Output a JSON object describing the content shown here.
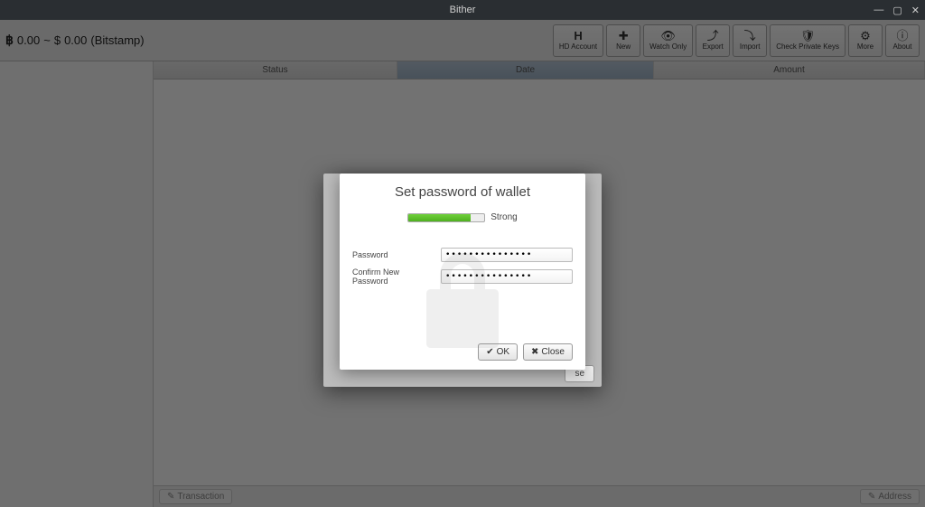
{
  "window": {
    "title": "Bither"
  },
  "balance": {
    "btc_symbol": "฿",
    "btc_amount": "0.00",
    "separator": "~",
    "fiat_symbol": "$",
    "fiat_amount": "0.00",
    "exchange": "(Bitstamp)"
  },
  "toolbar": {
    "hd_account": "HD Account",
    "new": "New",
    "watch_only": "Watch Only",
    "export": "Export",
    "import": "Import",
    "check_keys": "Check Private Keys",
    "more": "More",
    "about": "About"
  },
  "columns": {
    "status": "Status",
    "date": "Date",
    "amount": "Amount"
  },
  "bottombar": {
    "transaction": "Transaction",
    "address": "Address"
  },
  "modal": {
    "title": "Set password of wallet",
    "strength_label": "Strong",
    "password_label": "Password",
    "confirm_label": "Confirm New Password",
    "password_value": "•••••••••••••••",
    "confirm_value": "•••••••••••••••",
    "ok": "OK",
    "close": "Close"
  },
  "outer_modal": {
    "close": "se"
  }
}
